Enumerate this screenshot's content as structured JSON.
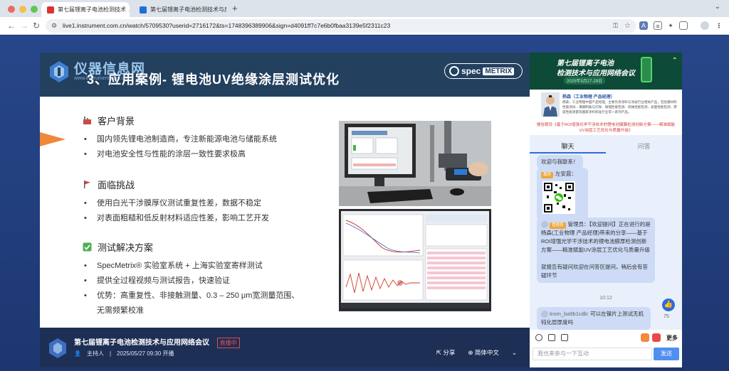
{
  "browser": {
    "tabs": [
      {
        "title": "第七届锂离子电池检测技术",
        "active": true
      },
      {
        "title": "第七届锂离子电池检测技术与应",
        "active": false
      }
    ],
    "new_tab": "+",
    "url": "live1.instrument.com.cn/watch/5709530?userid=2716172&ts=1748396389906&sign=d4091ff7c7e6b0fbaa3139e5f2311c23"
  },
  "slide": {
    "logo_text": "仪器信息网",
    "logo_url": "www.instrument.com.cn",
    "title": "3、应用案例- 锂电池UV绝缘涂层测试优化",
    "brand_spec": "spec",
    "brand_metrix": "METRIX",
    "sections": [
      {
        "heading": "客户背景",
        "bullets": [
          "国内领先锂电池制造商，专注新能源电池与储能系统",
          "对电池安全性与性能的涂层一致性要求极高"
        ]
      },
      {
        "heading": "面临挑战",
        "bullets": [
          "使用白光干涉膜厚仪测试重复性差，数据不稳定",
          "对表面粗糙和低反射材料适应性差，影响工艺开发"
        ]
      },
      {
        "heading": "测试解决方案",
        "bullets": [
          "SpecMetrix® 实验室系统 + 上海实验室寄样测试",
          "提供全过程视频与测试报告，快速验证",
          "优势：高重复性、非接触测量、0.3 – 250 μm宽测量范围、"
        ],
        "continuation": "无需频繁校准"
      }
    ]
  },
  "bottom_bar": {
    "title": "第七届锂离子电池检测技术与应用网络会议",
    "live_badge": "直播中",
    "host": "主持人",
    "datetime": "2025/05/27 09:30 开播",
    "share": "分享",
    "language": "简体中文"
  },
  "sidebar": {
    "banner_line1": "第七届锂离子电池",
    "banner_line2": "检测技术与应用网络会议",
    "banner_date": "2025年5月27-29日",
    "speaker_name": "杨森（工业物理 产品经理）",
    "speaker_bio": "杨森，工业物理中国产品经理，主要负责涂料与涂层行业相关产品，包括膜材料性能测试、薄膜制备与打样、微理性能检测、机械性能检测、表面性能检测、厚度性能测量等国家涂料标准行业等一系列产品。",
    "report_title": "报告题目《基于ROI增强光学干涉技术的锂电池膜膜检测创新方案——精准赋能UV涂层工艺优化与质量升级》",
    "tab_chat": "聊天",
    "tab_qa": "问答",
    "messages": [
      {
        "text": "欢迎与我联系！"
      },
      {
        "tag": "嘉宾",
        "user": "左安晨："
      },
      {
        "tag": "管理员",
        "user": "管理员：",
        "text": "【欢迎提问】正在进行的是杨森(工业物理 产品经理)带来的分享——基于ROI增强光学干涉技术的锂电池膜厚检测创新方案——精准赋能UV涂层工艺优化与质量升级",
        "text2": "就报告有疑问欢迎在问答区提问，稍后会有答疑环节"
      },
      {
        "user": "lnsm_ba9b1cdb:",
        "text": "可以在镍片上测试无机钝化层厚度吗"
      }
    ],
    "time": "10:12",
    "like_count": "75",
    "more": "更多",
    "input_placeholder": "我也来参与一下互动",
    "send": "发送"
  },
  "colors": {
    "accent": "#2e6bd9",
    "slide_header": "#23405f",
    "page_bg": "#203c78",
    "orange": "#f0873a",
    "live_red": "#e24b4b"
  }
}
